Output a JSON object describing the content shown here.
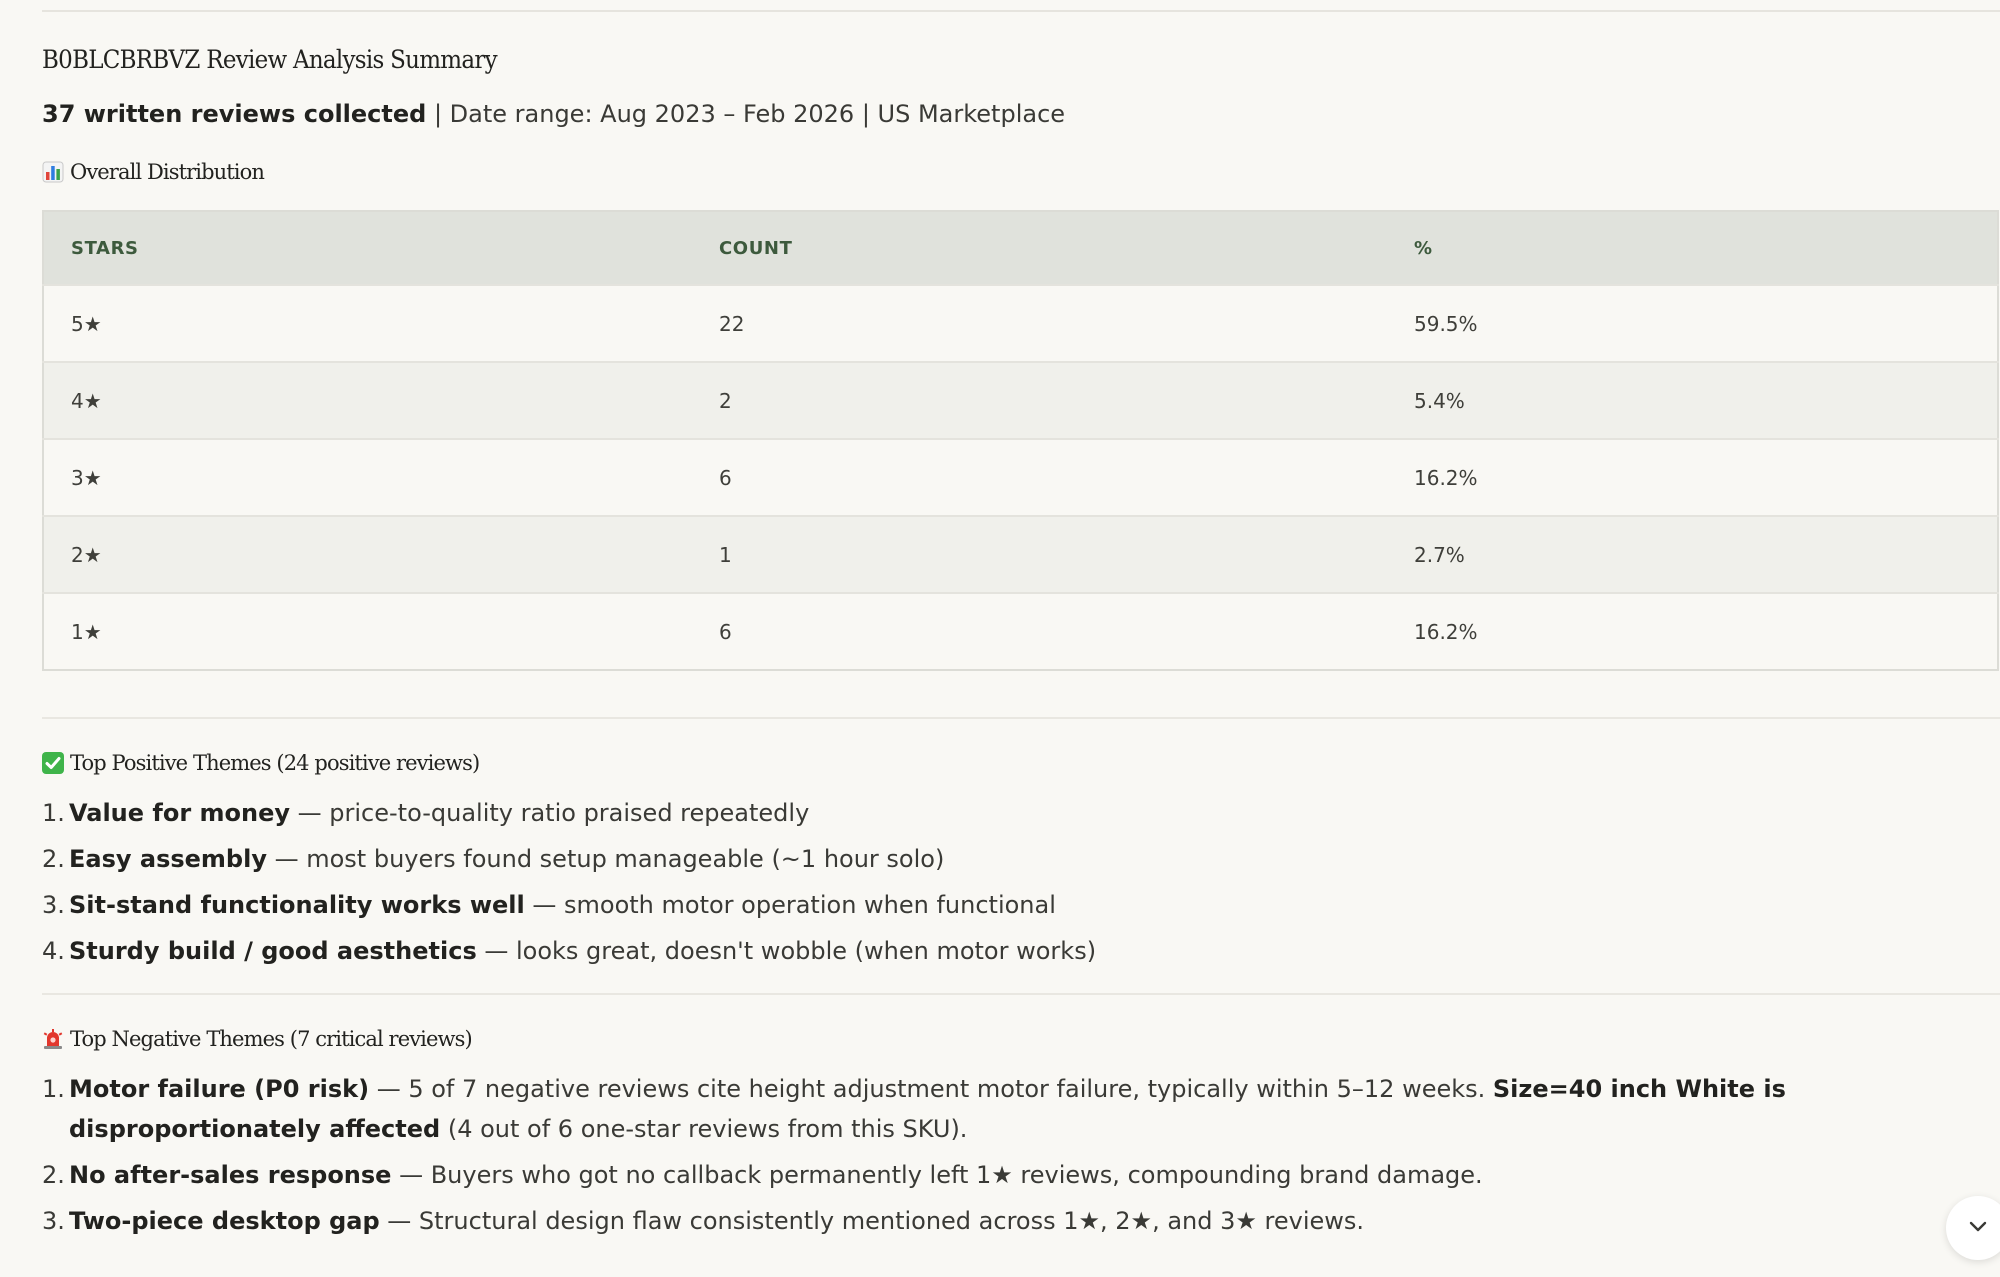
{
  "report": {
    "title": "B0BLCBRBVZ Review Analysis Summary",
    "summary_bold": "37 written reviews collected",
    "summary_rest": " | Date range: Aug 2023 – Feb 2026 | US Marketplace"
  },
  "distribution": {
    "heading": "Overall Distribution",
    "icon": "bar-chart-icon",
    "columns": [
      "STARS",
      "COUNT",
      "%"
    ],
    "rows": [
      {
        "stars": "5★",
        "count": "22",
        "pct": "59.5%"
      },
      {
        "stars": "4★",
        "count": "2",
        "pct": "5.4%"
      },
      {
        "stars": "3★",
        "count": "6",
        "pct": "16.2%"
      },
      {
        "stars": "2★",
        "count": "1",
        "pct": "2.7%"
      },
      {
        "stars": "1★",
        "count": "6",
        "pct": "16.2%"
      }
    ]
  },
  "positive": {
    "heading": "Top Positive Themes (24 positive reviews)",
    "icon": "check-mark-icon",
    "items": [
      {
        "num": "1.",
        "bold": "Value for money",
        "text": " — price-to-quality ratio praised repeatedly"
      },
      {
        "num": "2.",
        "bold": "Easy assembly",
        "text": " — most buyers found setup manageable (~1 hour solo)"
      },
      {
        "num": "3.",
        "bold": "Sit-stand functionality works well",
        "text": " — smooth motor operation when functional"
      },
      {
        "num": "4.",
        "bold": "Sturdy build / good aesthetics",
        "text": " — looks great, doesn't wobble (when motor works)"
      }
    ]
  },
  "negative": {
    "heading": "Top Negative Themes (7 critical reviews)",
    "icon": "siren-icon",
    "items": [
      {
        "num": "1.",
        "bold": "Motor failure (P0 risk)",
        "text": " — 5 of 7 negative reviews cite height adjustment motor failure, typically within 5–12 weeks. ",
        "bold2": "Size=40 inch White is disproportionately affected",
        "text2": " (4 out of 6 one-star reviews from this SKU)."
      },
      {
        "num": "2.",
        "bold": "No after-sales response",
        "text": " — Buyers who got no callback permanently left 1★ reviews, compounding brand damage.",
        "bold2": "",
        "text2": ""
      },
      {
        "num": "3.",
        "bold": "Two-piece desktop gap",
        "text": " — Structural design flaw consistently mentioned across 1★, 2★, and 3★ reviews.",
        "bold2": "",
        "text2": ""
      }
    ]
  },
  "colors": {
    "background": "#f9f8f4",
    "header_bg": "#e0e2dc",
    "header_text": "#3d5a3d"
  }
}
